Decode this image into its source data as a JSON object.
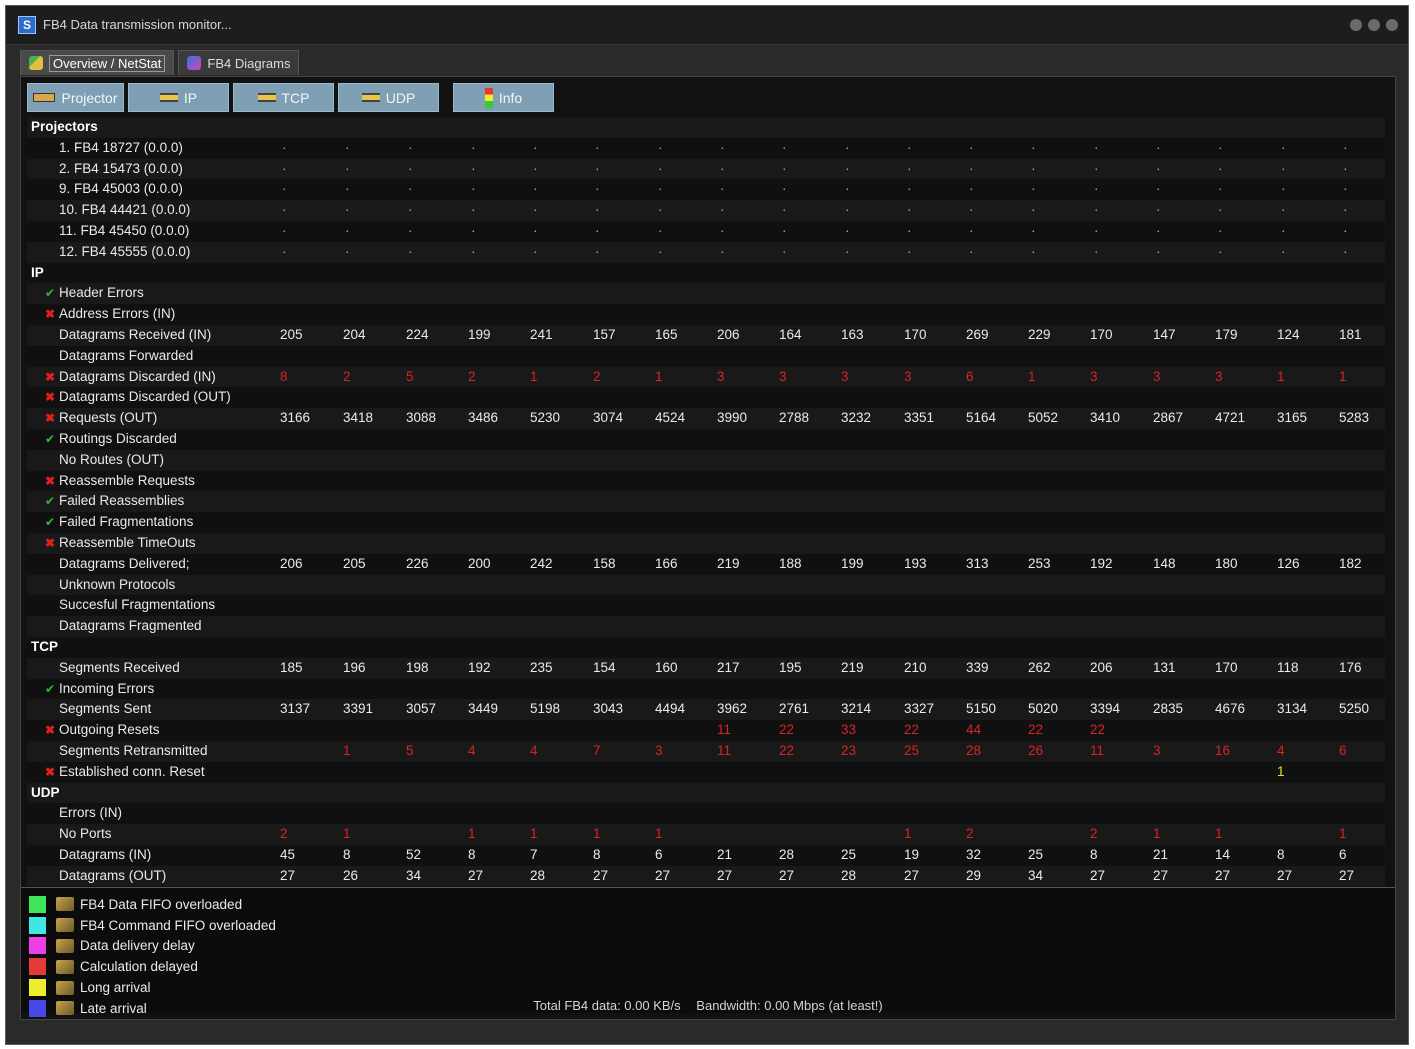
{
  "window": {
    "title": "FB4 Data transmission monitor..."
  },
  "tabs": [
    {
      "label": "Overview / NetStat",
      "active": true
    },
    {
      "label": "FB4 Diagrams",
      "active": false
    }
  ],
  "toolbar": [
    "Projector",
    "IP",
    "TCP",
    "UDP",
    "Info"
  ],
  "rows": [
    {
      "type": "section",
      "label": "Projectors"
    },
    {
      "label": "1. FB4 18727 (0.0.0)",
      "dots": true
    },
    {
      "label": "2. FB4 15473 (0.0.0)",
      "dots": true
    },
    {
      "label": "9. FB4 45003 (0.0.0)",
      "dots": true
    },
    {
      "label": "10. FB4 44421 (0.0.0)",
      "dots": true
    },
    {
      "label": "11. FB4 45450 (0.0.0)",
      "dots": true
    },
    {
      "label": "12. FB4 45555 (0.0.0)",
      "dots": true
    },
    {
      "type": "section",
      "label": "IP"
    },
    {
      "label": "Header Errors",
      "status": "ok"
    },
    {
      "label": "Address Errors (IN)",
      "status": "err"
    },
    {
      "label": "Datagrams Received (IN)",
      "values": [
        "205",
        "204",
        "224",
        "199",
        "241",
        "157",
        "165",
        "206",
        "164",
        "163",
        "170",
        "269",
        "229",
        "170",
        "147",
        "179",
        "124",
        "181"
      ]
    },
    {
      "label": "Datagrams Forwarded"
    },
    {
      "label": "Datagrams Discarded (IN)",
      "status": "err",
      "color": "red",
      "values": [
        "8",
        "2",
        "5",
        "2",
        "1",
        "2",
        "1",
        "3",
        "3",
        "3",
        "3",
        "6",
        "1",
        "3",
        "3",
        "3",
        "1",
        "1"
      ]
    },
    {
      "label": "Datagrams Discarded (OUT)",
      "status": "err"
    },
    {
      "label": "Requests (OUT)",
      "status": "err",
      "values": [
        "3166",
        "3418",
        "3088",
        "3486",
        "5230",
        "3074",
        "4524",
        "3990",
        "2788",
        "3232",
        "3351",
        "5164",
        "5052",
        "3410",
        "2867",
        "4721",
        "3165",
        "5283"
      ]
    },
    {
      "label": "Routings Discarded",
      "status": "ok"
    },
    {
      "label": "No Routes (OUT)"
    },
    {
      "label": "Reassemble Requests",
      "status": "err"
    },
    {
      "label": "Failed Reassemblies",
      "status": "ok"
    },
    {
      "label": "Failed Fragmentations",
      "status": "ok"
    },
    {
      "label": "Reassemble TimeOuts",
      "status": "err"
    },
    {
      "label": "Datagrams Delivered;",
      "values": [
        "206",
        "205",
        "226",
        "200",
        "242",
        "158",
        "166",
        "219",
        "188",
        "199",
        "193",
        "313",
        "253",
        "192",
        "148",
        "180",
        "126",
        "182"
      ]
    },
    {
      "label": "Unknown Protocols"
    },
    {
      "label": "Succesful Fragmentations"
    },
    {
      "label": "Datagrams Fragmented"
    },
    {
      "type": "section",
      "label": "TCP"
    },
    {
      "label": "Segments Received",
      "values": [
        "185",
        "196",
        "198",
        "192",
        "235",
        "154",
        "160",
        "217",
        "195",
        "219",
        "210",
        "339",
        "262",
        "206",
        "131",
        "170",
        "118",
        "176"
      ]
    },
    {
      "label": "Incoming Errors",
      "status": "ok"
    },
    {
      "label": "Segments Sent",
      "values": [
        "3137",
        "3391",
        "3057",
        "3449",
        "5198",
        "3043",
        "4494",
        "3962",
        "2761",
        "3214",
        "3327",
        "5150",
        "5020",
        "3394",
        "2835",
        "4676",
        "3134",
        "5250"
      ]
    },
    {
      "label": "Outgoing Resets",
      "status": "err",
      "color": "red",
      "values": [
        "",
        "",
        "",
        "",
        "",
        "",
        "",
        "11",
        "22",
        "33",
        "22",
        "44",
        "22",
        "22",
        "",
        "",
        "",
        ""
      ]
    },
    {
      "label": "Segments Retransmitted",
      "color": "red",
      "values": [
        "",
        "1",
        "5",
        "4",
        "4",
        "7",
        "3",
        "11",
        "22",
        "23",
        "25",
        "28",
        "26",
        "11",
        "3",
        "16",
        "4",
        "6"
      ]
    },
    {
      "label": "Established conn. Reset",
      "status": "err",
      "color": "yellow",
      "values": [
        "",
        "",
        "",
        "",
        "",
        "",
        "",
        "",
        "",
        "",
        "",
        "",
        "",
        "",
        "",
        "",
        "1",
        ""
      ]
    },
    {
      "type": "section",
      "label": "UDP"
    },
    {
      "label": "Errors (IN)"
    },
    {
      "label": "No Ports",
      "color": "red",
      "values": [
        "2",
        "1",
        "",
        "1",
        "1",
        "1",
        "1",
        "",
        "",
        "",
        "1",
        "2",
        "",
        "2",
        "1",
        "1",
        "",
        "1"
      ]
    },
    {
      "label": "Datagrams (IN)",
      "values": [
        "45",
        "8",
        "52",
        "8",
        "7",
        "8",
        "6",
        "21",
        "28",
        "25",
        "19",
        "32",
        "25",
        "8",
        "21",
        "14",
        "8",
        "6"
      ]
    },
    {
      "label": "Datagrams (OUT)",
      "values": [
        "27",
        "26",
        "34",
        "27",
        "28",
        "27",
        "27",
        "27",
        "27",
        "28",
        "27",
        "29",
        "34",
        "27",
        "27",
        "27",
        "27",
        "27"
      ]
    }
  ],
  "legend": [
    {
      "label": "FB4 Data FIFO overloaded",
      "color": "#3ee65a",
      "icon": "fifo-icon"
    },
    {
      "label": "FB4 Command FIFO overloaded",
      "color": "#3ee6e6",
      "icon": "fifo-icon"
    },
    {
      "label": "Data delivery delay",
      "color": "#ee3ee6",
      "icon": "delivery-icon"
    },
    {
      "label": "Calculation delayed",
      "color": "#e63a3a",
      "icon": "calc-icon"
    },
    {
      "label": "Long arrival",
      "color": "#eeee2e",
      "icon": "arrival-icon"
    },
    {
      "label": "Late arrival",
      "color": "#4848e6",
      "icon": "late-icon"
    }
  ],
  "status": {
    "total": "Total FB4 data: 0.00 KB/s",
    "bandwidth": "Bandwidth: 0.00 Mbps (at least!)"
  }
}
